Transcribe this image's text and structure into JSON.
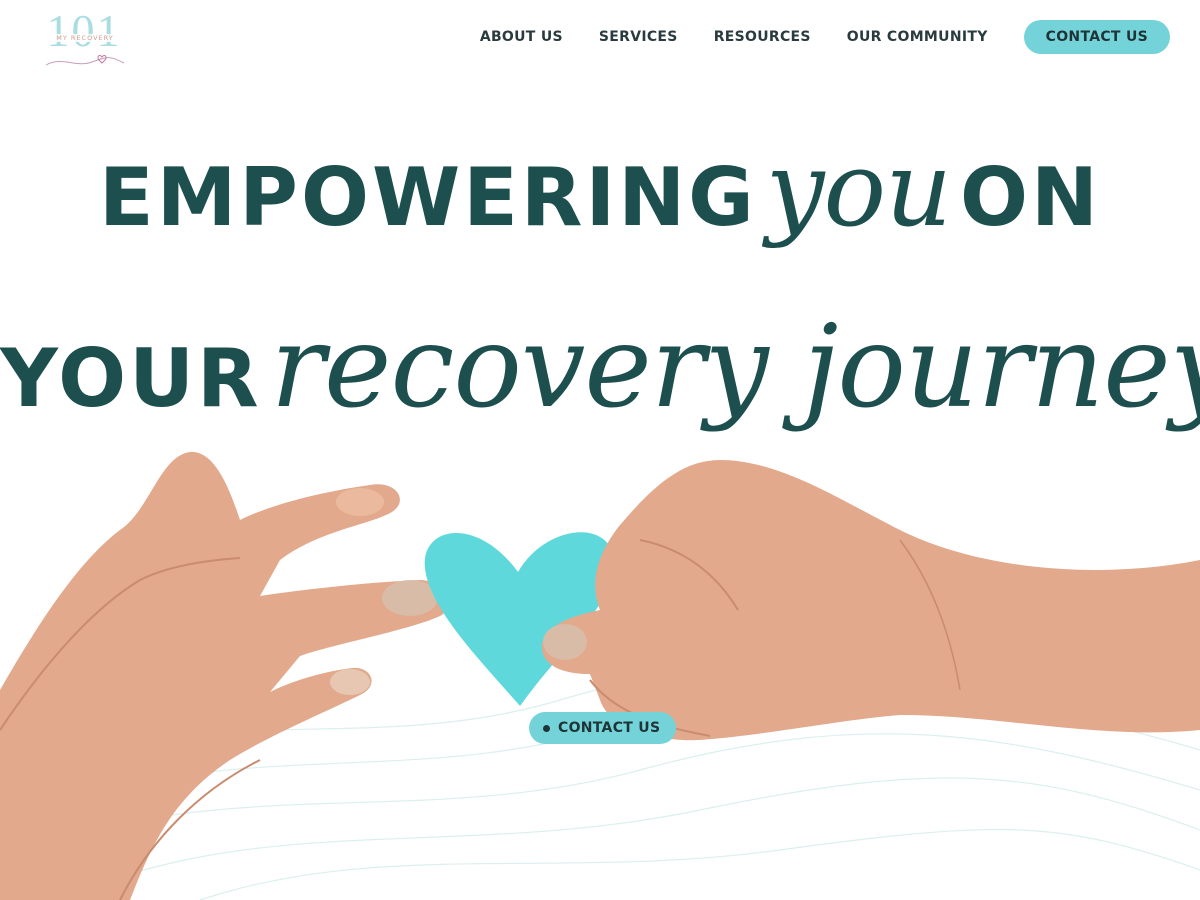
{
  "brand": {
    "logo_number": "101",
    "logo_text": "MY RECOVERY"
  },
  "nav": {
    "items": [
      "ABOUT US",
      "SERVICES",
      "RESOURCES",
      "OUR COMMUNITY"
    ],
    "cta_label": "CONTACT US"
  },
  "hero": {
    "line1": {
      "word1": "EMPOWERING",
      "script": "you",
      "word2": "ON"
    },
    "line2": {
      "word1": "YOUR",
      "script": "recovery journey"
    },
    "cta_label": "CONTACT US",
    "image_icons": [
      "left-hand-icon",
      "right-hand-icon",
      "paper-heart-icon"
    ]
  },
  "colors": {
    "brand_teal": "#74d3d9",
    "heading_teal": "#1e4f4f",
    "nav_text": "#2a3b3f",
    "heart": "#5fd8dc"
  }
}
